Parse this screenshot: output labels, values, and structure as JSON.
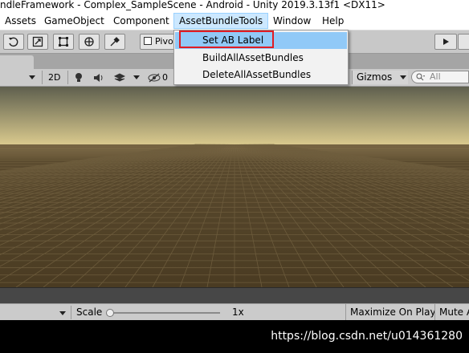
{
  "window": {
    "title": "ndleFramework - Complex_SampleScene - Android - Unity 2019.3.13f1 <DX11>"
  },
  "menubar": {
    "items": [
      {
        "label": "Assets"
      },
      {
        "label": "GameObject"
      },
      {
        "label": "Component"
      },
      {
        "label": "AssetBundleTools"
      },
      {
        "label": "Window"
      },
      {
        "label": "Help"
      }
    ]
  },
  "toolbar": {
    "tools": [
      "rotate-tool-icon",
      "scale-tool-icon",
      "rect-tool-icon",
      "transform-tool-icon",
      "custom-tool-icon"
    ],
    "pivot_label": "Pivot"
  },
  "scene_toolbar": {
    "mode_2d": "2D",
    "hidden_count": "0",
    "gizmos_label": "Gizmos",
    "search_placeholder": "All"
  },
  "dropdown": {
    "items": [
      {
        "label": "Set AB Label"
      },
      {
        "label": "BuildAllAssetBundles"
      },
      {
        "label": "DeleteAllAssetBundles"
      }
    ],
    "highlight_color": "#91c9f7",
    "outline_color": "#e01c24"
  },
  "statusbar": {
    "scale_label": "Scale",
    "scale_value": "1x",
    "maximize_label": "Maximize On Play",
    "mute_label": "Mute A"
  },
  "footer": {
    "watermark": "https://blog.csdn.net/u014361280"
  },
  "colors": {
    "sky_top": "#5e5f4e",
    "horizon": "#d9c98d",
    "ground": "#4e3f25"
  }
}
